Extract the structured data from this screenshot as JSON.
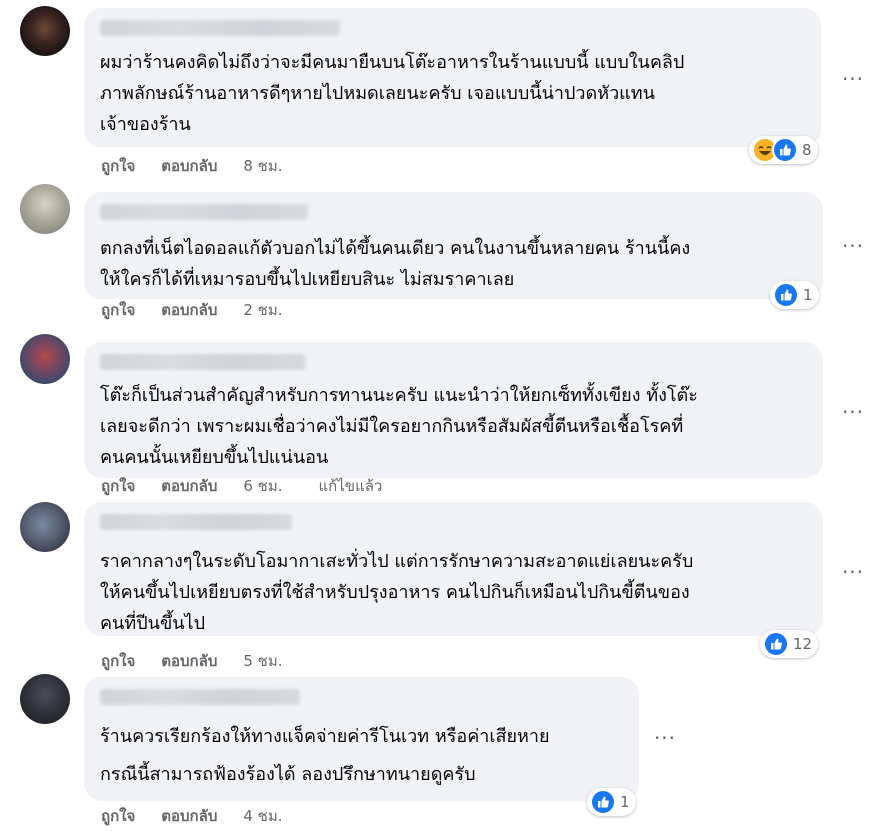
{
  "comments": [
    {
      "lines": [
        "ผมว่าร้านคงคิดไม่ถึงว่าจะมีคนมายืนบนโต๊ะอาหารในร้านแบบนี้ แบบในคลิป",
        "ภาพลักษณ์ร้านอาหารดีๆหายไปหมดเลยนะครับ เจอแบบนี้น่าปวดหัวแทน",
        "เจ้าของร้าน"
      ],
      "like_label": "ถูกใจ",
      "reply_label": "ตอบกลับ",
      "time": "8 ชม.",
      "reactions": [
        "haha",
        "like"
      ],
      "reaction_count": "8"
    },
    {
      "lines": [
        "ตกลงที่เน็ตไอดอลแก้ตัวบอกไม่ได้ขึ้นคนเดียว คนในงานขึ้นหลายคน ร้านนี้คง",
        "ให้ใครก็ได้ที่เหมารอบขึ้นไปเหยียบสินะ ไม่สมราคาเลย"
      ],
      "like_label": "ถูกใจ",
      "reply_label": "ตอบกลับ",
      "time": "2 ชม.",
      "reactions": [
        "like"
      ],
      "reaction_count": "1"
    },
    {
      "lines": [
        "โต๊ะก็เป็นส่วนสำคัญสำหรับการทานนะครับ แนะนำว่าให้ยกเซ็ททั้งเขียง ทั้งโต๊ะ",
        "เลยจะดีกว่า เพราะผมเชื่อว่าคงไม่มีใครอยากกินหรือสัมผัสขี้ตีนหรือเชื้อโรคที่",
        "คนคนนั้นเหยียบขึ้นไปแน่นอน"
      ],
      "like_label": "ถูกใจ",
      "reply_label": "ตอบกลับ",
      "time": "6 ชม.",
      "edited": "แก้ไขแล้ว"
    },
    {
      "lines": [
        "ราคากลางๆในระดับโอมากาเสะทั่วไป แต่การรักษาความสะอาดแย่เลยนะครับ",
        "ให้คนขึ้นไปเหยียบตรงที่ใช้สำหรับปรุงอาหาร คนไปกินก็เหมือนไปกินขี้ตีนของ",
        "คนที่ปีนขึ้นไป"
      ],
      "like_label": "ถูกใจ",
      "reply_label": "ตอบกลับ",
      "time": "5 ชม.",
      "reactions": [
        "like"
      ],
      "reaction_count": "12"
    },
    {
      "lines": [
        "ร้านควรเรียกร้องให้ทางแจ็คจ่ายค่ารีโนเวท หรือค่าเสียหาย",
        "กรณีนี้สามารถฟ้องร้องได้ ลองปรึกษาทนายดูครับ"
      ],
      "like_label": "ถูกใจ",
      "reply_label": "ตอบกลับ",
      "time": "4 ชม.",
      "reactions": [
        "like"
      ],
      "reaction_count": "1"
    }
  ],
  "icons": {
    "more": "more-horizontal-icon",
    "like": "like-thumb-icon",
    "haha": "haha-emoji-icon"
  },
  "colors": {
    "bubble": "#f0f2f5",
    "like_blue": "#1877f2",
    "meta_gray": "#65676b"
  }
}
